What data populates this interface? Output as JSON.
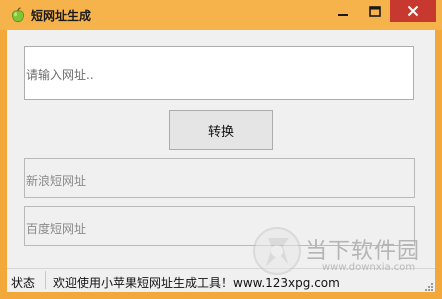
{
  "window": {
    "title": "短网址生成",
    "app_icon": "apple-icon",
    "colors": {
      "frame": "#f2a83a",
      "titlebar": "#f6b24b",
      "close": "#c7392f",
      "client": "#f0f0f0"
    }
  },
  "titlebar_buttons": {
    "minimize": "minimize-icon",
    "maximize": "maximize-icon",
    "close": "close-icon"
  },
  "main": {
    "url_input": {
      "placeholder": "请输入网址.."
    },
    "convert_button": "转换",
    "sina_field": {
      "placeholder": "新浪短网址"
    },
    "baidu_field": {
      "placeholder": "百度短网址"
    }
  },
  "statusbar": {
    "label": "状态",
    "text": "欢迎使用小苹果短网址生成工具！www.123xpg.com"
  },
  "watermark": {
    "text": "当下软件园",
    "url": "www.downxia.com",
    "logo": "downxia-logo-icon"
  }
}
